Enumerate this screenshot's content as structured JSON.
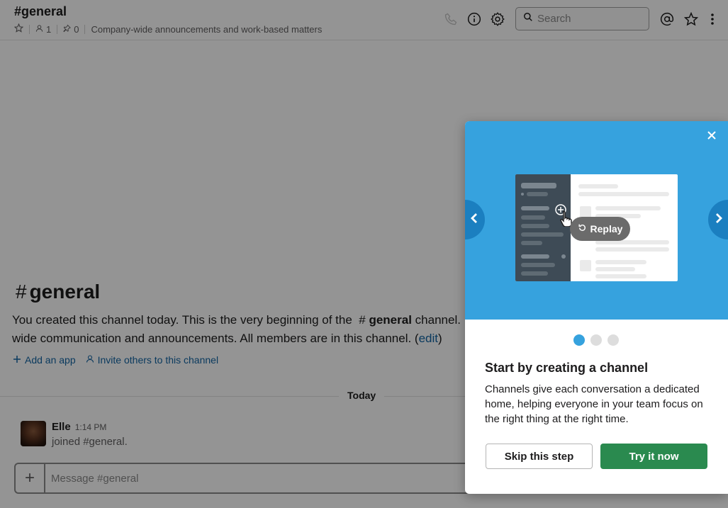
{
  "header": {
    "title": "#general",
    "member_count": "1",
    "pinned_count": "0",
    "topic": "Company-wide announcements and work-based matters",
    "search_placeholder": "Search",
    "icons": [
      "star-icon",
      "member-icon",
      "pin-icon",
      "phone-icon",
      "info-icon",
      "gear-icon",
      "search-icon",
      "mention-icon",
      "star-icon",
      "more-icon"
    ]
  },
  "intro": {
    "hash": "#",
    "title": "general",
    "text_1": "You created this channel today. This is the very beginning of the",
    "text_channel_hash": "#",
    "text_channel_name": "general",
    "text_2": "channel.",
    "text_3": "wide communication and announcements. All members are in this channel. (",
    "edit_link": "edit",
    "text_4": ")",
    "add_app": "Add an app",
    "invite": "Invite others to this channel"
  },
  "day_divider": "Today",
  "message": {
    "author": "Elle",
    "time": "1:14 PM",
    "text": "joined #general."
  },
  "composer": {
    "plus": "+",
    "placeholder": "Message #general"
  },
  "popup": {
    "replay_label": "Replay",
    "dots": {
      "total": 3,
      "active": 1
    },
    "title": "Start by creating a channel",
    "description": "Channels give each conversation a dedicated home, helping everyone in your team focus on the right thing at the right time.",
    "skip_label": "Skip this step",
    "try_label": "Try it now"
  },
  "colors": {
    "accent_blue": "#36a2de",
    "try_green": "#2a8a4f",
    "link_blue": "#1264a3"
  }
}
